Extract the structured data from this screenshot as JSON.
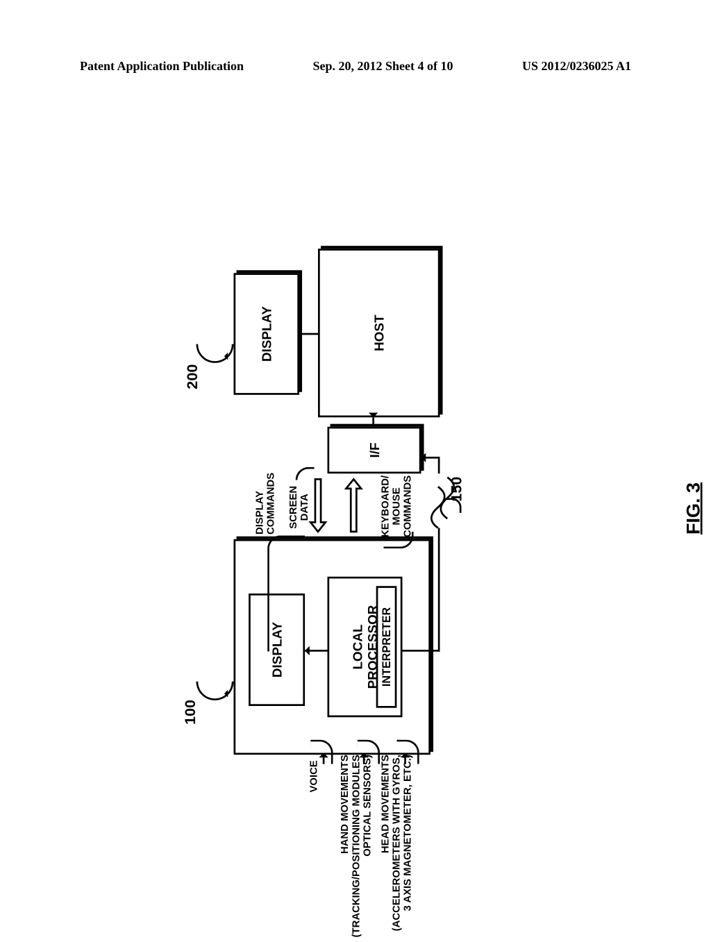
{
  "header": {
    "left": "Patent Application Publication",
    "middle": "Sep. 20, 2012  Sheet 4 of 10",
    "right": "US 2012/0236025 A1"
  },
  "refs": {
    "r100": "100",
    "r200": "200",
    "r150": "150"
  },
  "labels": {
    "display": "DISPLAY",
    "local_processor_l1": "LOCAL",
    "local_processor_l2": "PROCESSOR",
    "interpreter": "INTERPRETER",
    "host": "HOST",
    "iface": "I/F",
    "voice": "VOICE",
    "hand_l1": "HAND MOVEMENTS",
    "hand_l2": "(TRACKING/POSITIONING MODULES",
    "hand_l3": "OPTICAL SENSORS)",
    "head_l1": "HEAD MOVEMENTS",
    "head_l2": "(ACCELEROMETERS WITH GYROS,",
    "head_l3": "3 AXIS MAGNETOMETER, ETC.)",
    "disp_cmd_l1": "DISPLAY",
    "disp_cmd_l2": "COMMANDS",
    "kbm_l1": "KEYBOARD/",
    "kbm_l2": "MOUSE",
    "kbm_l3": "COMMANDS",
    "scr_l1": "SCREEN",
    "scr_l2": "DATA"
  },
  "figure": "FIG. 3"
}
